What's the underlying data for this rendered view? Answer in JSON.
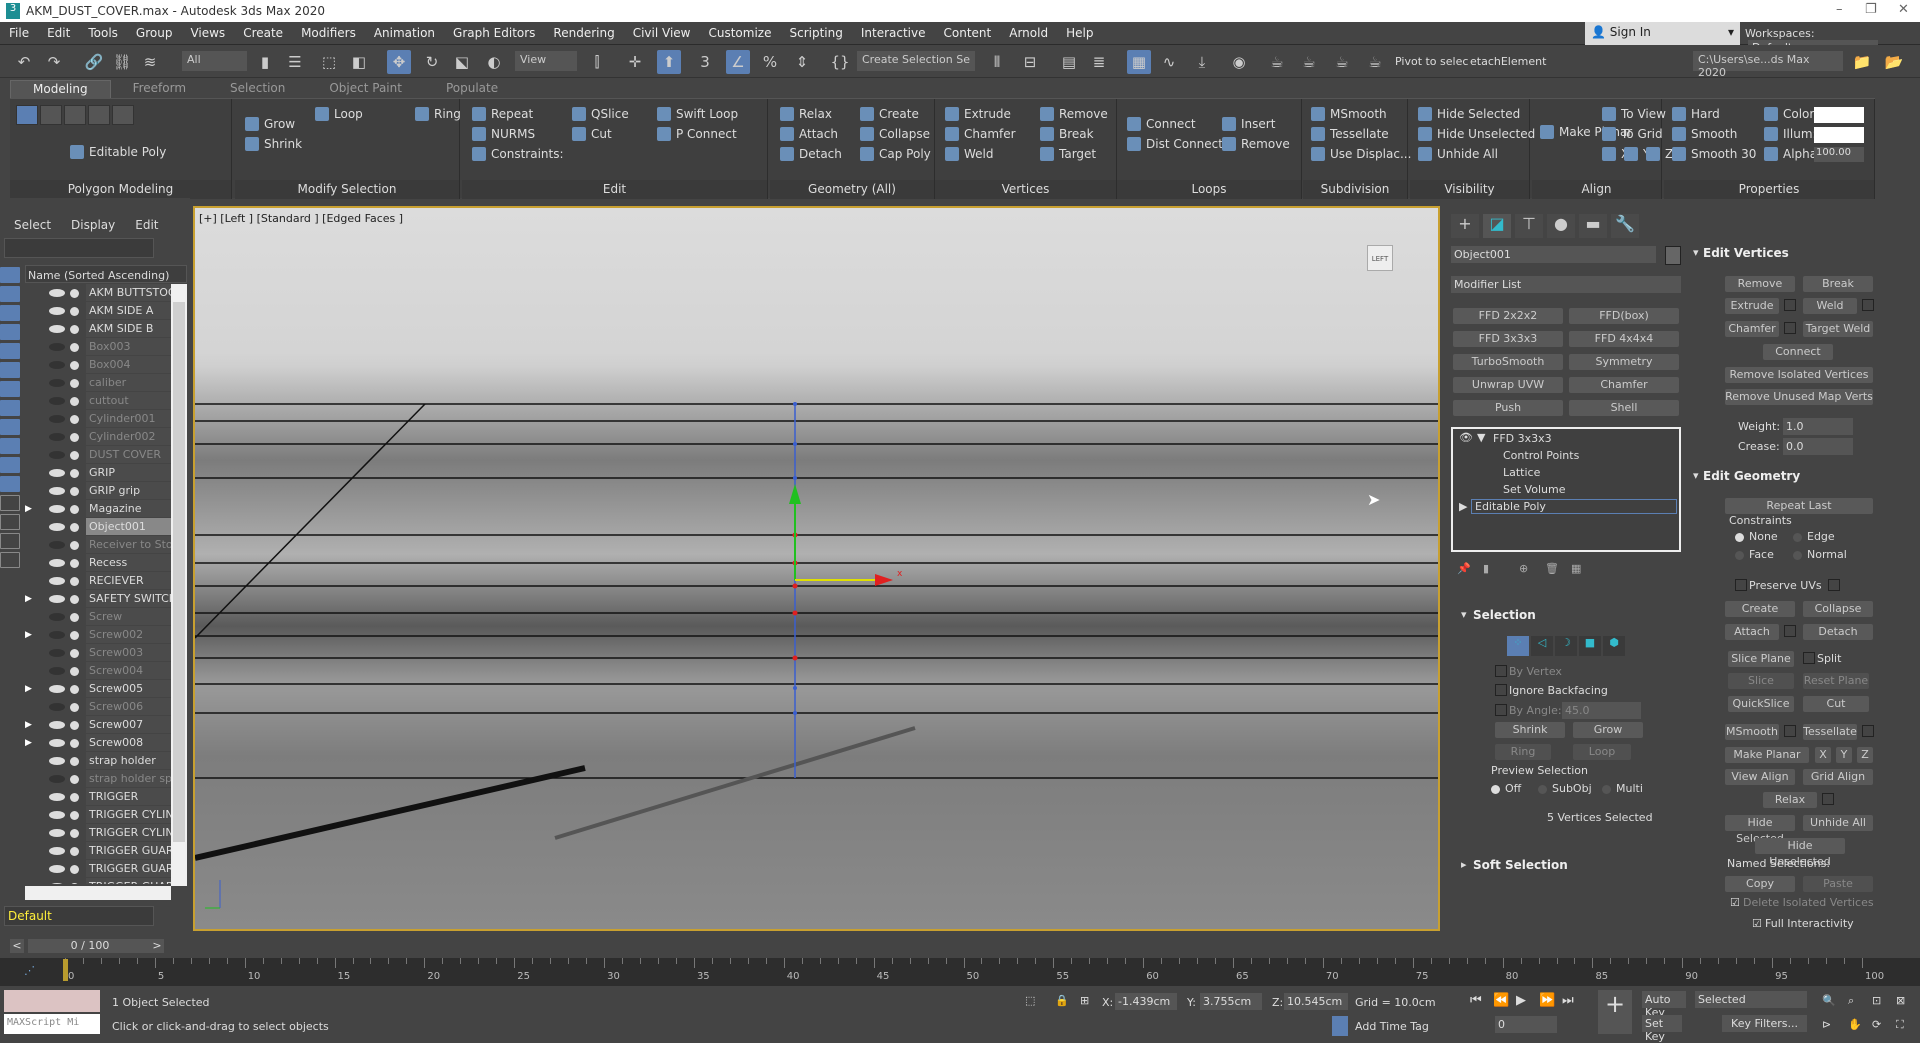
{
  "title": "AKM_DUST_COVER.max - Autodesk 3ds Max 2020",
  "menu": [
    "File",
    "Edit",
    "Tools",
    "Group",
    "Views",
    "Create",
    "Modifiers",
    "Animation",
    "Graph Editors",
    "Rendering",
    "Civil View",
    "Customize",
    "Scripting",
    "Interactive",
    "Content",
    "Arnold",
    "Help"
  ],
  "sign_in": "Sign In",
  "workspaces_label": "Workspaces:",
  "workspace": "Default",
  "toolbar": {
    "filter": "All",
    "ref_coord": "View",
    "selection_set": "Create Selection Se",
    "pivot": "Pivot to selec",
    "detach": "etachElement",
    "project_path": "C:\\Users\\se...ds Max 2020"
  },
  "ribbon_tabs": [
    "Modeling",
    "Freeform",
    "Selection",
    "Object Paint",
    "Populate"
  ],
  "ribbon_groups": [
    {
      "name": "Polygon Modeling",
      "items": [
        {
          "t": "Editable Poly"
        }
      ]
    },
    {
      "name": "Modify Selection",
      "items": [
        {
          "t": "Grow"
        },
        {
          "t": "Shrink"
        },
        {
          "t": "Loop"
        },
        {
          "t": "Ring"
        }
      ]
    },
    {
      "name": "Edit",
      "items": [
        {
          "t": "Repeat"
        },
        {
          "t": "NURMS"
        },
        {
          "t": "Constraints:"
        },
        {
          "t": "QSlice"
        },
        {
          "t": "Cut"
        },
        {
          "t": "Swift Loop"
        },
        {
          "t": "P Connect"
        }
      ]
    },
    {
      "name": "Geometry (All)",
      "items": [
        {
          "t": "Relax"
        },
        {
          "t": "Attach"
        },
        {
          "t": "Detach"
        },
        {
          "t": "Create"
        },
        {
          "t": "Collapse"
        },
        {
          "t": "Cap Poly"
        }
      ]
    },
    {
      "name": "Vertices",
      "items": [
        {
          "t": "Extrude"
        },
        {
          "t": "Chamfer"
        },
        {
          "t": "Weld"
        },
        {
          "t": "Remove"
        },
        {
          "t": "Break"
        },
        {
          "t": "Target"
        }
      ]
    },
    {
      "name": "Loops",
      "items": [
        {
          "t": "Connect"
        },
        {
          "t": "Dist Connect"
        },
        {
          "t": "Insert"
        },
        {
          "t": "Remove"
        }
      ]
    },
    {
      "name": "Subdivision",
      "items": [
        {
          "t": "MSmooth"
        },
        {
          "t": "Tessellate"
        },
        {
          "t": "Use Displac..."
        }
      ]
    },
    {
      "name": "Visibility",
      "items": [
        {
          "t": "Hide Selected"
        },
        {
          "t": "Hide Unselected"
        },
        {
          "t": "Unhide All"
        }
      ]
    },
    {
      "name": "Align",
      "items": [
        {
          "t": "Make Planar"
        },
        {
          "t": "To View"
        },
        {
          "t": "To Grid"
        },
        {
          "t": "X"
        },
        {
          "t": "Y"
        },
        {
          "t": "Z"
        }
      ]
    },
    {
      "name": "Properties",
      "items": [
        {
          "t": "Hard"
        },
        {
          "t": "Smooth"
        },
        {
          "t": "Smooth 30"
        },
        {
          "t": "Color:"
        },
        {
          "t": "Illum:"
        },
        {
          "t": "Alpha:"
        }
      ]
    }
  ],
  "alpha_value": "100.00",
  "spinner_value": "1",
  "scene_explorer": {
    "menu": [
      "Select",
      "Display",
      "Edit"
    ],
    "column": "Name (Sorted Ascending)",
    "layer": "Default",
    "items": [
      {
        "name": "AKM BUTTSTOCK",
        "visible": true
      },
      {
        "name": "AKM SIDE A",
        "visible": true
      },
      {
        "name": "AKM SIDE B",
        "visible": true
      },
      {
        "name": "Box003",
        "visible": false
      },
      {
        "name": "Box004",
        "visible": false
      },
      {
        "name": "caliber",
        "visible": false
      },
      {
        "name": "cuttout",
        "visible": false
      },
      {
        "name": "Cylinder001",
        "visible": false
      },
      {
        "name": "Cylinder002",
        "visible": false
      },
      {
        "name": "DUST COVER",
        "visible": false
      },
      {
        "name": "GRIP",
        "visible": true
      },
      {
        "name": "GRIP grip",
        "visible": true
      },
      {
        "name": "Magazine",
        "visible": true,
        "children": true
      },
      {
        "name": "Object001",
        "visible": true,
        "selected": true
      },
      {
        "name": "Receiver to Stock",
        "visible": false
      },
      {
        "name": "Recess",
        "visible": true
      },
      {
        "name": "RECIEVER",
        "visible": true
      },
      {
        "name": "SAFETY SWITCH",
        "visible": true,
        "children": true
      },
      {
        "name": "Screw",
        "visible": false
      },
      {
        "name": "Screw002",
        "visible": false,
        "children": true
      },
      {
        "name": "Screw003",
        "visible": false
      },
      {
        "name": "Screw004",
        "visible": false
      },
      {
        "name": "Screw005",
        "visible": true,
        "children": true
      },
      {
        "name": "Screw006",
        "visible": false
      },
      {
        "name": "Screw007",
        "visible": true,
        "children": true
      },
      {
        "name": "Screw008",
        "visible": true,
        "children": true
      },
      {
        "name": "strap holder",
        "visible": true
      },
      {
        "name": "strap holder spline",
        "visible": false
      },
      {
        "name": "TRIGGER",
        "visible": true
      },
      {
        "name": "TRIGGER CYLINDER",
        "visible": true
      },
      {
        "name": "TRIGGER CYLINDER",
        "visible": true
      },
      {
        "name": "TRIGGER GUARD",
        "visible": true
      },
      {
        "name": "TRIGGER GUARD B",
        "visible": true
      },
      {
        "name": "TRIGGER GUARD B",
        "visible": true
      }
    ]
  },
  "viewport": {
    "label": "[+] [Left ] [Standard ] [Edged Faces ]",
    "viewcube": "LEFT"
  },
  "command_panel": {
    "object_name": "Object001",
    "modifier_list": "Modifier List",
    "modifier_buttons": [
      "FFD 2x2x2",
      "FFD(box)",
      "FFD 3x3x3",
      "FFD 4x4x4",
      "TurboSmooth",
      "Symmetry",
      "Unwrap UVW",
      "Chamfer",
      "Push",
      "Shell"
    ],
    "stack": {
      "ffd": "FFD 3x3x3",
      "sub": [
        "Control Points",
        "Lattice",
        "Set Volume"
      ],
      "base": "Editable Poly"
    },
    "selection": {
      "title": "Selection",
      "by_vertex": "By Vertex",
      "ignore_backfacing": "Ignore Backfacing",
      "by_angle": "By Angle:",
      "angle": "45.0",
      "shrink": "Shrink",
      "grow": "Grow",
      "ring": "Ring",
      "loop": "Loop",
      "preview": "Preview Selection",
      "off": "Off",
      "subobj": "SubObj",
      "multi": "Multi",
      "status": "5 Vertices Selected"
    },
    "soft_selection": "Soft Selection",
    "edit_vertices": {
      "title": "Edit Vertices",
      "remove": "Remove",
      "break": "Break",
      "extrude": "Extrude",
      "weld": "Weld",
      "chamfer": "Chamfer",
      "target_weld": "Target Weld",
      "connect": "Connect",
      "remove_isolated": "Remove Isolated Vertices",
      "remove_unused": "Remove Unused Map Verts",
      "weight_label": "Weight:",
      "weight": "1.0",
      "crease_label": "Crease:",
      "crease": "0.0"
    },
    "edit_geometry": {
      "title": "Edit Geometry",
      "repeat_last": "Repeat Last",
      "constraints": "Constraints",
      "none": "None",
      "edge": "Edge",
      "face": "Face",
      "normal": "Normal",
      "preserve_uvs": "Preserve UVs",
      "create": "Create",
      "collapse": "Collapse",
      "attach": "Attach",
      "detach": "Detach",
      "slice_plane": "Slice Plane",
      "split": "Split",
      "slice": "Slice",
      "reset_plane": "Reset Plane",
      "quickslice": "QuickSlice",
      "cut": "Cut",
      "msmooth": "MSmooth",
      "tessellate": "Tessellate",
      "make_planar": "Make Planar",
      "x": "X",
      "y": "Y",
      "z": "Z",
      "view_align": "View Align",
      "grid_align": "Grid Align",
      "relax": "Relax",
      "hide_selected": "Hide Selected",
      "unhide_all": "Unhide All",
      "hide_unselected": "Hide Unselected",
      "named_selections": "Named Selections:",
      "copy": "Copy",
      "paste": "Paste",
      "delete_isolated": "Delete Isolated Vertices",
      "full_interactivity": "Full Interactivity"
    }
  },
  "timeline": {
    "frame": "0 / 100",
    "ticks": [
      "0",
      "5",
      "10",
      "15",
      "20",
      "25",
      "30",
      "35",
      "40",
      "45",
      "50",
      "55",
      "60",
      "65",
      "70",
      "75",
      "80",
      "85",
      "90",
      "95",
      "100"
    ]
  },
  "status": {
    "selected": "1 Object Selected",
    "prompt": "Click or click-and-drag to select objects",
    "maxscript": "MAXScript Mi",
    "x_label": "X:",
    "x": "-1.439cm",
    "y_label": "Y:",
    "y": "3.755cm",
    "z_label": "Z:",
    "z": "10.545cm",
    "grid": "Grid = 10.0cm",
    "add_time_tag": "Add Time Tag",
    "auto_key": "Auto Key",
    "set_key": "Set Key",
    "key_mode": "Selected",
    "key_filters": "Key Filters...",
    "current_frame": "0"
  }
}
